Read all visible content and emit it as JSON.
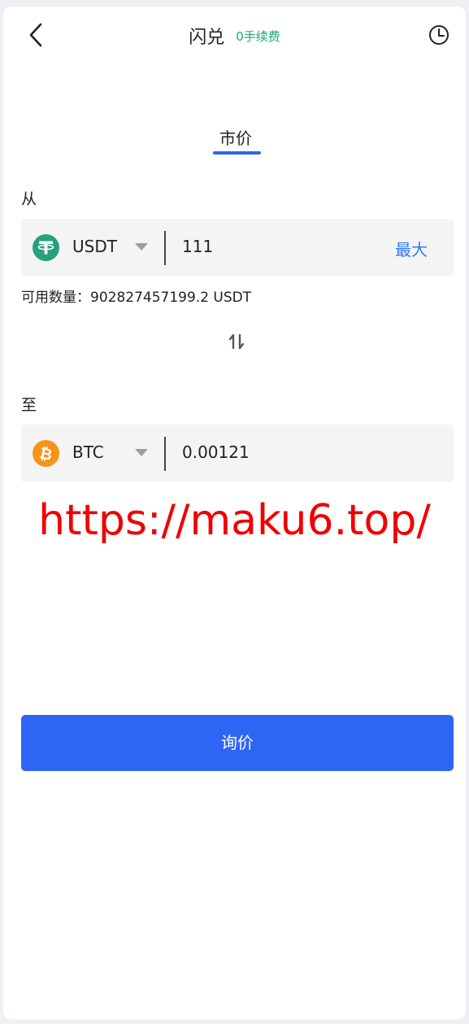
{
  "header": {
    "title": "闪兑",
    "fee_badge": "0手续费",
    "back_icon": "chevron-left-icon",
    "history_icon": "clock-icon"
  },
  "tabs": {
    "active": "市价"
  },
  "from": {
    "label": "从",
    "coin": "USDT",
    "coin_icon": "tether-icon",
    "coin_color": "#26a17b",
    "amount": "111",
    "max_label": "最大",
    "available_text": "可用数量：902827457199.2 USDT"
  },
  "swap_icon": "swap-vertical-icon",
  "to": {
    "label": "至",
    "coin": "BTC",
    "coin_icon": "bitcoin-icon",
    "coin_color": "#f7931a",
    "amount": "0.00121"
  },
  "watermark": "https://maku6.top/",
  "quote_button": "询价",
  "colors": {
    "accent": "#2f65f5",
    "fee_green": "#18a97a",
    "max_blue": "#2f7bf0",
    "watermark_red": "#f00000"
  }
}
